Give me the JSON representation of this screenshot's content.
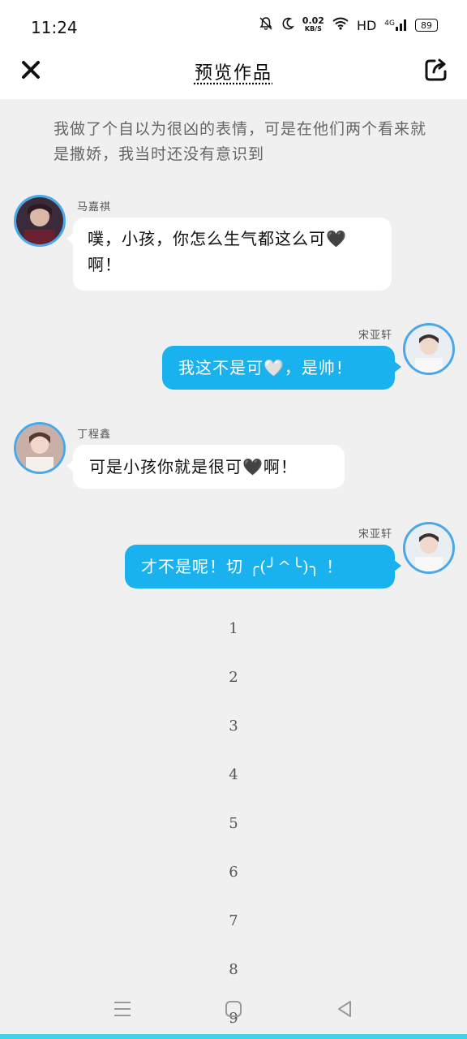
{
  "status_bar": {
    "time": "11:24",
    "speed_value": "0.02",
    "speed_unit": "KB/S",
    "hd": "HD",
    "network": "4G",
    "battery": "89"
  },
  "header": {
    "title": "预览作品",
    "close_icon": "close-icon",
    "share_icon": "share-icon"
  },
  "story": {
    "narration": "我做了个自以为很凶的表情，可是在他们两个看来就是撒娇，我当时还没有意识到",
    "messages": [
      {
        "side": "left",
        "sender": "马嘉祺",
        "text": "噗，小孩，你怎么生气都这么可🖤啊！"
      },
      {
        "side": "right",
        "sender": "宋亚轩",
        "text": "我这不是可🤍，是帅！"
      },
      {
        "side": "left",
        "sender": "丁程鑫",
        "text": "可是小孩你就是很可🖤啊！"
      },
      {
        "side": "right",
        "sender": "宋亚轩",
        "text": "才不是呢！切 ╭(╯^╰)╮ ！"
      }
    ],
    "page_numbers": [
      "1",
      "2",
      "3",
      "4",
      "5",
      "6",
      "7",
      "8",
      "9"
    ]
  },
  "colors": {
    "accent": "#1ab2ee",
    "avatar_border": "#4aa8e8",
    "background": "#f0f0f0",
    "bottom_bar": "#3dd4e6"
  },
  "nav": {
    "menu_icon": "menu-icon",
    "home_icon": "home-icon",
    "back_icon": "back-icon"
  }
}
